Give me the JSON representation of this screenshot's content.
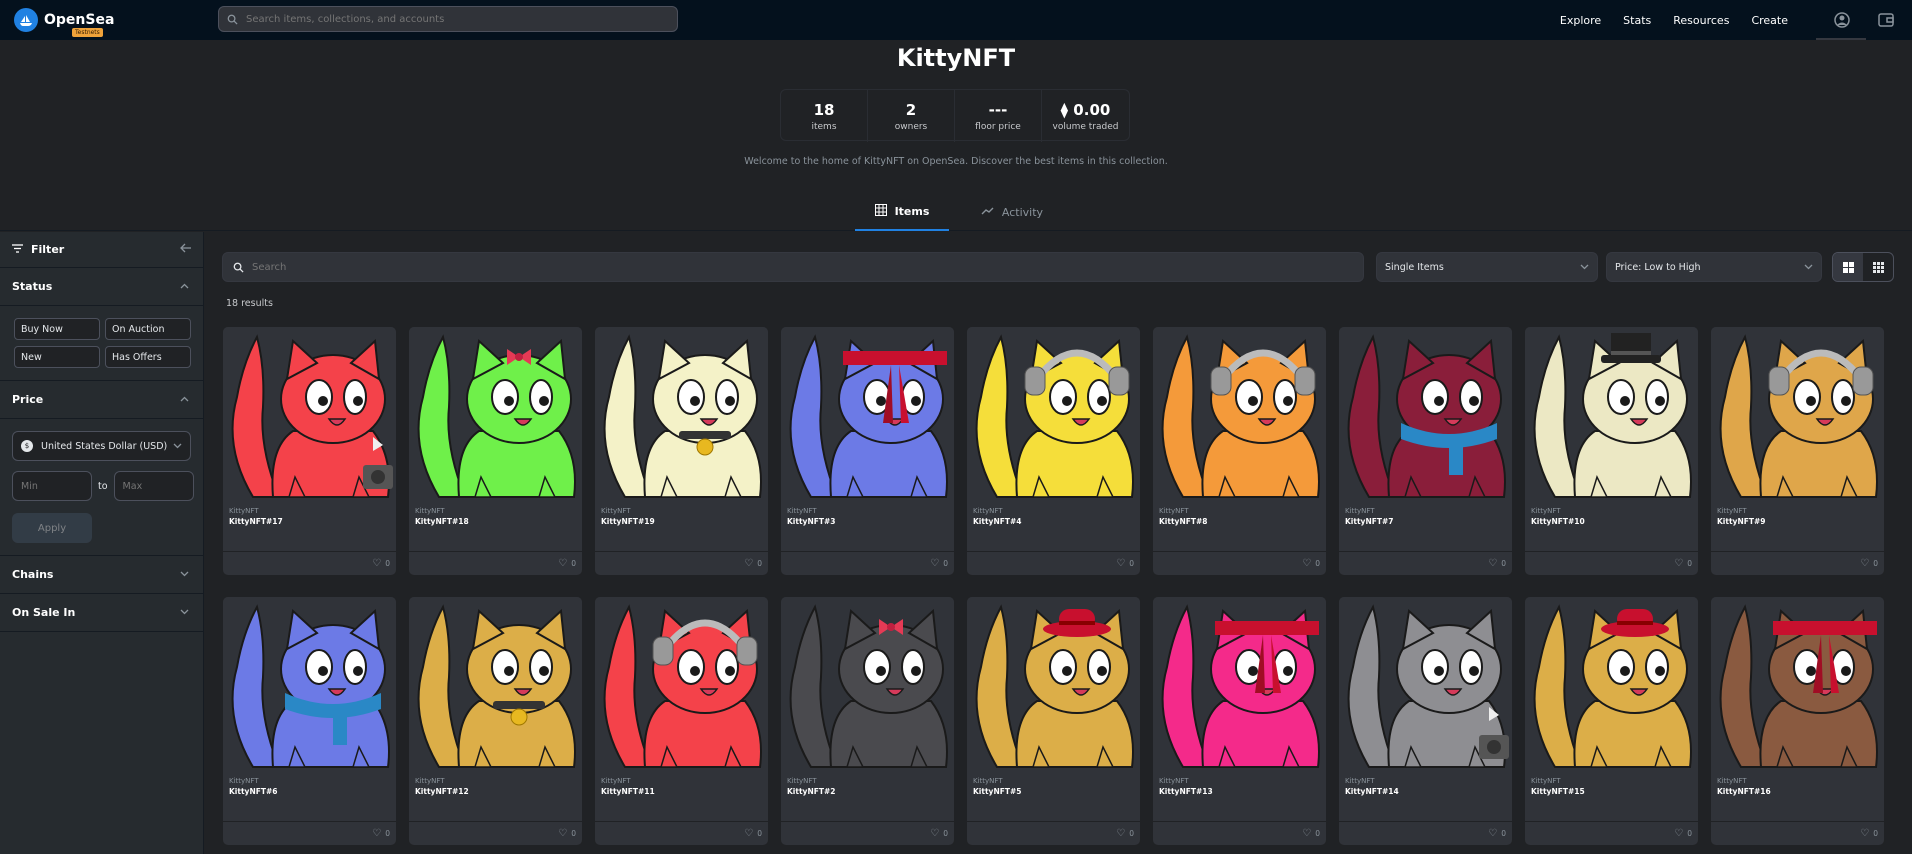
{
  "nav": {
    "brand": "OpenSea",
    "badge": "Testnets",
    "search_placeholder": "Search items, collections, and accounts",
    "links": [
      "Explore",
      "Stats",
      "Resources",
      "Create"
    ]
  },
  "collection": {
    "title": "KittyNFT",
    "stats": [
      {
        "value": "18",
        "label": "items"
      },
      {
        "value": "2",
        "label": "owners"
      },
      {
        "value": "---",
        "label": "floor price"
      },
      {
        "value": "⧫ 0.00",
        "label": "volume traded"
      }
    ],
    "description": "Welcome to the home of KittyNFT on OpenSea. Discover the best items in this collection."
  },
  "tabs": {
    "items": "Items",
    "activity": "Activity"
  },
  "sidebar": {
    "filter_label": "Filter",
    "status_label": "Status",
    "status_options": [
      "Buy Now",
      "On Auction",
      "New",
      "Has Offers"
    ],
    "price_label": "Price",
    "currency": "United States Dollar (USD)",
    "min_placeholder": "Min",
    "to_label": "to",
    "max_placeholder": "Max",
    "apply_label": "Apply",
    "chains_label": "Chains",
    "on_sale_label": "On Sale In"
  },
  "main": {
    "search_placeholder": "Search",
    "item_type": "Single Items",
    "sort": "Price: Low to High",
    "results": "18 results"
  },
  "colors": {
    "accent": "#2081e2",
    "nav_bg": "#04111d",
    "card_bg": "#303339"
  },
  "cards": [
    {
      "collection": "KittyNFT",
      "name": "KittyNFT#17",
      "likes": "0",
      "body": "#f4424a",
      "accessory": "camera"
    },
    {
      "collection": "KittyNFT",
      "name": "KittyNFT#18",
      "likes": "0",
      "body": "#6ff04a",
      "accessory": "bow"
    },
    {
      "collection": "KittyNFT",
      "name": "KittyNFT#19",
      "likes": "0",
      "body": "#f4f2c8",
      "accessory": "bell"
    },
    {
      "collection": "KittyNFT",
      "name": "KittyNFT#3",
      "likes": "0",
      "body": "#6c7ae6",
      "accessory": "headband"
    },
    {
      "collection": "KittyNFT",
      "name": "KittyNFT#4",
      "likes": "0",
      "body": "#f5de3a",
      "accessory": "headphones"
    },
    {
      "collection": "KittyNFT",
      "name": "KittyNFT#8",
      "likes": "0",
      "body": "#f49a3a",
      "accessory": "headphones"
    },
    {
      "collection": "KittyNFT",
      "name": "KittyNFT#7",
      "likes": "0",
      "body": "#8a1e3a",
      "accessory": "scarf"
    },
    {
      "collection": "KittyNFT",
      "name": "KittyNFT#10",
      "likes": "0",
      "body": "#ece8c4",
      "accessory": "tophat"
    },
    {
      "collection": "KittyNFT",
      "name": "KittyNFT#9",
      "likes": "0",
      "body": "#dfa64a",
      "accessory": "headphones"
    },
    {
      "collection": "KittyNFT",
      "name": "KittyNFT#6",
      "likes": "0",
      "body": "#6c7ae6",
      "accessory": "scarf"
    },
    {
      "collection": "KittyNFT",
      "name": "KittyNFT#12",
      "likes": "0",
      "body": "#dcae48",
      "accessory": "bell"
    },
    {
      "collection": "KittyNFT",
      "name": "KittyNFT#11",
      "likes": "0",
      "body": "#f4424a",
      "accessory": "headphones"
    },
    {
      "collection": "KittyNFT",
      "name": "KittyNFT#2",
      "likes": "0",
      "body": "#4a4a4e",
      "accessory": "bow"
    },
    {
      "collection": "KittyNFT",
      "name": "KittyNFT#5",
      "likes": "0",
      "body": "#dcae48",
      "accessory": "hat"
    },
    {
      "collection": "KittyNFT",
      "name": "KittyNFT#13",
      "likes": "0",
      "body": "#f42a8a",
      "accessory": "headband"
    },
    {
      "collection": "KittyNFT",
      "name": "KittyNFT#14",
      "likes": "0",
      "body": "#8e8e92",
      "accessory": "camera"
    },
    {
      "collection": "KittyNFT",
      "name": "KittyNFT#15",
      "likes": "0",
      "body": "#dcae48",
      "accessory": "hat"
    },
    {
      "collection": "KittyNFT",
      "name": "KittyNFT#16",
      "likes": "0",
      "body": "#8a5a40",
      "accessory": "headband"
    }
  ]
}
